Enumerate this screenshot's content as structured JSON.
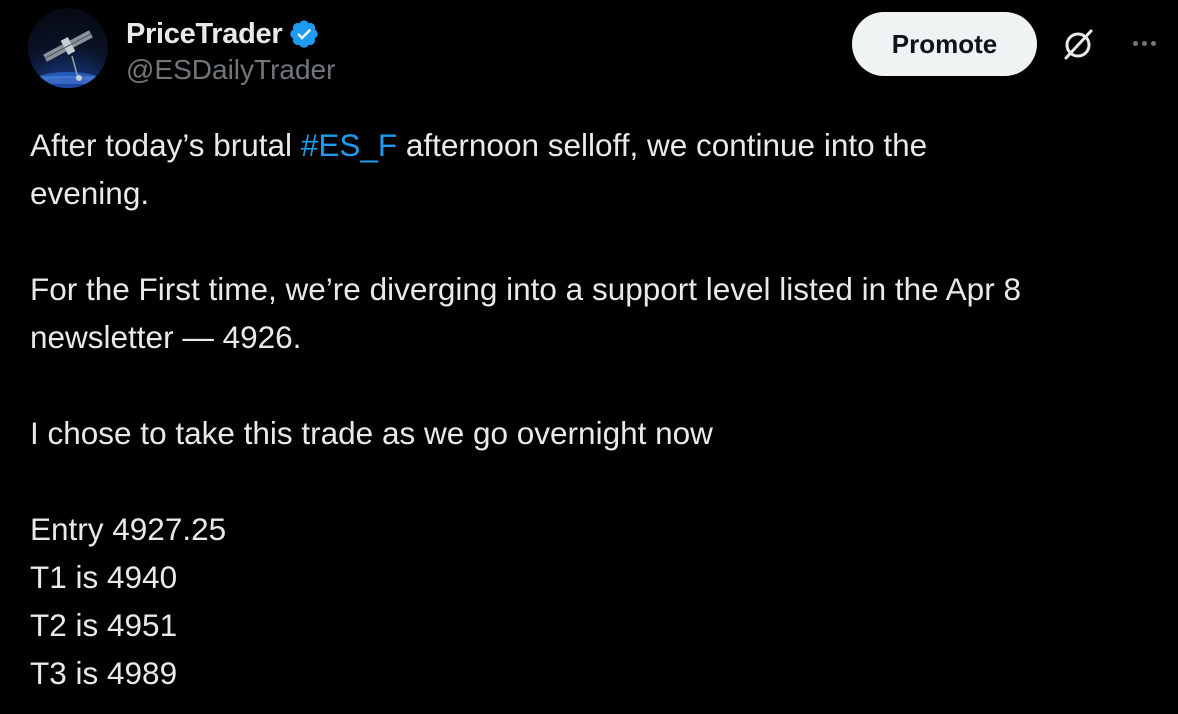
{
  "author": {
    "display_name": "PriceTrader",
    "handle": "@ESDailyTrader",
    "verified_badge_color": "#1d9bf0"
  },
  "actions": {
    "promote_label": "Promote",
    "grok_icon": "grok-icon",
    "more_icon": "more-icon"
  },
  "tweet": {
    "line1_pre": "After today’s brutal ",
    "hashtag": "#ES_F",
    "line1_post": " afternoon selloff, we continue into the",
    "line1_cont": "evening.",
    "para2_line1": "For the First time, we’re diverging into a support level listed in the Apr 8",
    "para2_line2": "newsletter — 4926.",
    "para3": "I chose to take this trade as we go overnight now",
    "entry": "Entry 4927.25",
    "t1": "T1 is 4940",
    "t2": "T2 is 4951",
    "t3": "T3 is 4989"
  },
  "colors": {
    "background": "#000000",
    "text": "#e7e9ea",
    "muted": "#71767b",
    "link": "#1d9bf0",
    "button_bg": "#eff3f4"
  }
}
